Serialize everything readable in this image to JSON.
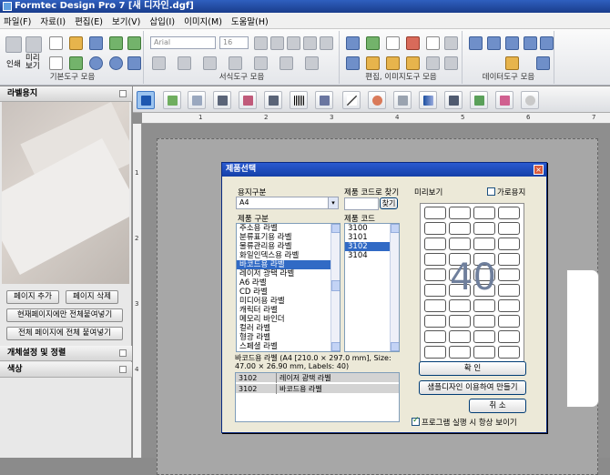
{
  "app": {
    "title": "Formtec Design Pro 7 [새 디자인.dgf]"
  },
  "menu": [
    "파일(F)",
    "자료(I)",
    "편집(E)",
    "보기(V)",
    "삽입(I)",
    "이미지(M)",
    "도움말(H)"
  ],
  "ribbon": {
    "print_label": "인쇄",
    "preview_label": "미리\n보기",
    "basic_group": "기본도구 모음",
    "font_name": "Arial",
    "font_size": "16",
    "format_group": "서식도구 모음",
    "edit_group": "편집, 이미지도구 모음",
    "data_group": "데이터도구 모음"
  },
  "sidebar": {
    "label_panel": "라벨용지",
    "add_page": "페이지 추가",
    "delete_page": "페이지 삭제",
    "paste_current": "현재페이지에만 전체붙여넣기",
    "paste_all": "전체 페이지에 전체 붙여넣기",
    "object_panel": "개체설정 및 정렬",
    "color_panel": "색상"
  },
  "dialog": {
    "title": "제품선택",
    "paper_type_label": "용지구분",
    "paper_type_value": "A4",
    "code_search_label": "제품 코드로 찾기",
    "search_button": "찾기",
    "preview_label": "미리보기",
    "landscape_label": "가로용지",
    "category_label": "제품 구분",
    "code_label": "제품 코드",
    "categories": [
      "주소용 라벨",
      "분류표기용 라벨",
      "물류관리용 라벨",
      "화일인덱스용 라벨",
      "바코드용 라벨",
      "레이저 광택 라벨",
      "A6 라벨",
      "CD 라벨",
      "미디어용 라벨",
      "캐릭터 라벨",
      "메모리 바인더",
      "컬러 라벨",
      "형광 라벨",
      "스페셜 라벨"
    ],
    "selected_category": "바코드용 라벨",
    "codes": [
      "3100",
      "3101",
      "3102",
      "3104"
    ],
    "selected_code": "3102",
    "preview_count": "40",
    "description": "바코드용 라벨 (A4 [210.0 × 297.0 mm], Size: 47.00 × 26.90 mm, Labels: 40)",
    "results": [
      {
        "code": "3102",
        "name": "레이저 광택 라벨"
      },
      {
        "code": "3102",
        "name": "바코드용 라벨"
      }
    ],
    "ok_button": "확 인",
    "sample_button": "샘플디자인 이용하여 만들기",
    "cancel_button": "취 소",
    "startup_check_label": "프로그램 실행 시 항상 보이기"
  },
  "ruler": {
    "top_marks": [
      "1",
      "2",
      "3",
      "4",
      "5",
      "6",
      "7"
    ],
    "left_marks": [
      "1",
      "2",
      "3",
      "4"
    ]
  },
  "colors": {
    "titlebar": "#1a3d8c",
    "selection": "#316ac5",
    "canvas": "#8e8e8e"
  }
}
